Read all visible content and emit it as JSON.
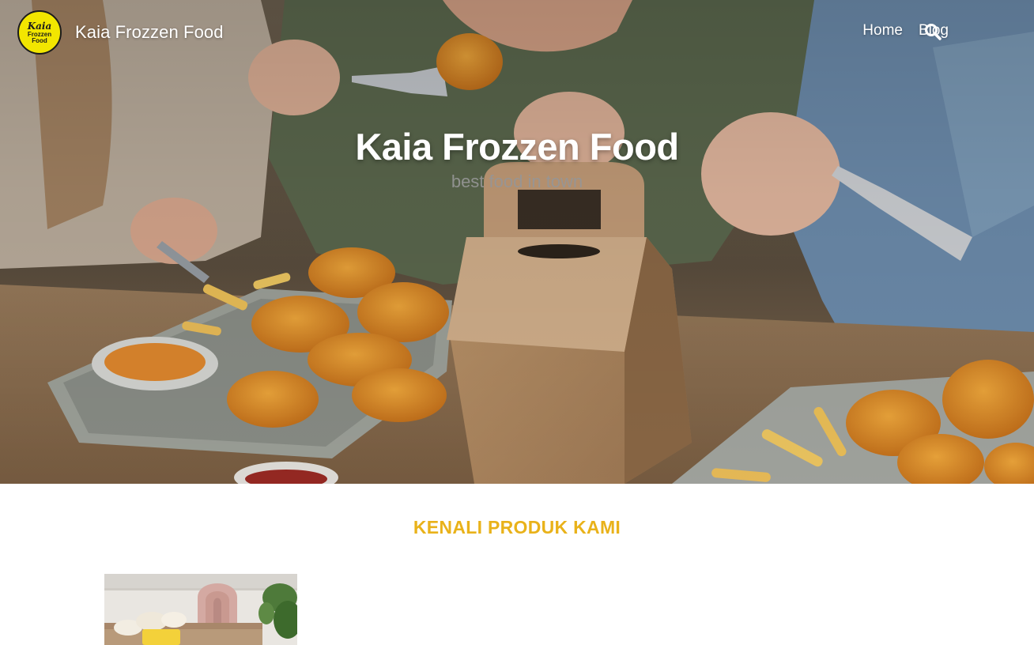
{
  "header": {
    "logo": {
      "line1": "Kaia",
      "line2": "Frozzen",
      "line3": "Food",
      "icon": "brand-logo-icon"
    },
    "site_title": "Kaia Frozzen Food",
    "nav": {
      "home": "Home",
      "blog": "Blog",
      "search_icon": "search-icon"
    }
  },
  "hero": {
    "title": "Kaia Frozzen Food",
    "tagline": "best food in town",
    "image": "hero-food-photo"
  },
  "products": {
    "heading": "KENALI PRODUK KAMI",
    "items": [
      {
        "image": "product-photo"
      }
    ]
  },
  "colors": {
    "accent": "#e9b21a",
    "logo_yellow": "#f2e600",
    "nav_text": "#ffffff"
  }
}
